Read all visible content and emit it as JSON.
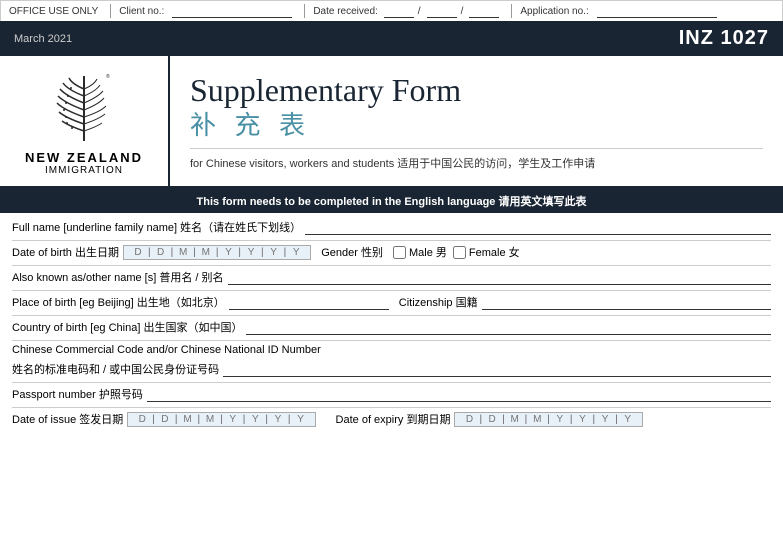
{
  "office_bar": {
    "office_use": "OFFICE USE ONLY",
    "client_label": "Client no.:",
    "date_label": "Date received:",
    "date_sep1": "/",
    "date_sep2": "/",
    "app_label": "Application no.:"
  },
  "header": {
    "date": "March 2021",
    "form_number": "INZ 1027"
  },
  "title": {
    "en": "Supplementary Form",
    "zh": "补 充 表",
    "subtitle_en": "for Chinese visitors, workers and students",
    "subtitle_zh": "适用于中国公民的访问，学生及工作申请"
  },
  "notice": {
    "text": "This form needs to be completed in the English language 请用英文填写此表"
  },
  "form": {
    "full_name_label": "Full name [underline family name] 姓名（请在姓氏下划线）",
    "dob_label": "Date of birth 出生日期",
    "gender_label": "Gender 性别",
    "male_label": "Male 男",
    "female_label": "Female 女",
    "also_known_label": "Also known as/other name [s] 普用名 / 别名",
    "place_birth_label": "Place of birth [eg Beijing] 出生地（如北京）",
    "citizenship_label": "Citizenship 国籍",
    "country_birth_label": "Country of birth [eg China] 出生国家（如中国）",
    "chinese_code_label1": "Chinese Commercial Code and/or Chinese National ID Number",
    "chinese_code_label2": "姓名的标准电码和 / 或中国公民身份证号码",
    "passport_label": "Passport number 护照号码",
    "date_issue_label": "Date of issue 签发日期",
    "date_expiry_label": "Date of expiry 到期日期"
  },
  "logo": {
    "country": "NEW ZEALAND",
    "dept": "IMMIGRATION"
  }
}
